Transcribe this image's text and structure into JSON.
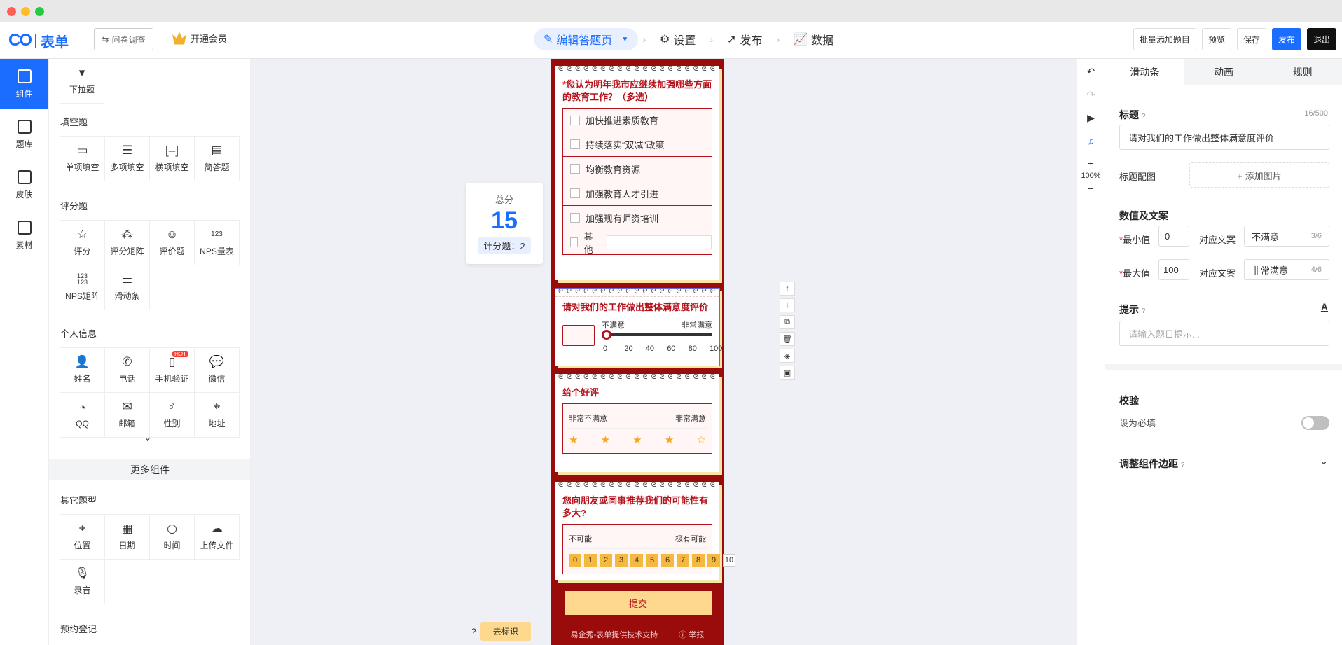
{
  "header": {
    "logo_mark": "CO",
    "logo_text": "表单",
    "survey_btn": "问卷调查",
    "vip": "开通会员",
    "steps": [
      "编辑答题页",
      "设置",
      "发布",
      "数据"
    ],
    "buttons": {
      "batch": "批量添加题目",
      "preview": "预览",
      "save": "保存",
      "publish": "发布",
      "exit": "退出"
    }
  },
  "leftnav": [
    {
      "label": "组件"
    },
    {
      "label": "题库"
    },
    {
      "label": "皮肤"
    },
    {
      "label": "素材"
    }
  ],
  "panel": {
    "dropdown_label": "下拉题",
    "fill_title": "填空题",
    "fill_items": [
      "单项填空",
      "多项填空",
      "横项填空",
      "简答题"
    ],
    "rating_title": "评分题",
    "rating_items": [
      "评分",
      "评分矩阵",
      "评价题",
      "NPS量表",
      "NPS矩阵",
      "滑动条"
    ],
    "personal_title": "个人信息",
    "personal_items": [
      "姓名",
      "电话",
      "手机验证",
      "微信",
      "QQ",
      "邮箱",
      "性别",
      "地址"
    ],
    "hot": "HOT",
    "more": "更多组件",
    "other_title": "其它题型",
    "other_items": [
      "位置",
      "日期",
      "时间",
      "上传文件",
      "录音"
    ],
    "booking_title": "预约登记"
  },
  "score": {
    "label": "总分",
    "value": "15",
    "count": "计分题：2"
  },
  "q1": {
    "star": "*",
    "title": "您认为明年我市应继续加强哪些方面的教育工作？（多选）",
    "options": [
      "加快推进素质教育",
      "持续落实“双减”政策",
      "均衡教育资源",
      "加强教育人才引进",
      "加强现有师资培训",
      "其他"
    ]
  },
  "q2": {
    "title": "请对我们的工作做出整体满意度评价",
    "min_text": "不满意",
    "max_text": "非常满意",
    "ticks": [
      "0",
      "20",
      "40",
      "60",
      "80",
      "100"
    ],
    "value": 0
  },
  "q3": {
    "title": "给个好评",
    "min_text": "非常不满意",
    "max_text": "非常满意",
    "stars_filled": 4,
    "stars_total": 5
  },
  "q4": {
    "title": "您向朋友或同事推荐我们的可能性有多大?",
    "min_text": "不可能",
    "max_text": "极有可能",
    "nums": [
      "0",
      "1",
      "2",
      "3",
      "4",
      "5",
      "6",
      "7",
      "8",
      "9",
      "10"
    ]
  },
  "submit": "提交",
  "footer_support": "易企秀-表单提供技术支持",
  "footer_report": "举报",
  "remove_mark": "去标识",
  "zoom": "100%",
  "rpanel": {
    "tabs": [
      "滑动条",
      "动画",
      "规则"
    ],
    "title_label": "标题",
    "title_count": "16/500",
    "title_value": "请对我们的工作做出整体满意度评价",
    "img_label": "标题配图",
    "img_btn": "+ 添加图片",
    "values_label": "数值及文案",
    "min_label": "最小值",
    "min_val": "0",
    "map_label": "对应文案",
    "min_text": "不满意",
    "min_count": "3/6",
    "max_label": "最大值",
    "max_val": "100",
    "max_text": "非常满意",
    "max_count": "4/6",
    "hint_label": "提示",
    "hint_placeholder": "请输入题目提示...",
    "check_label": "校验",
    "required_label": "设为必填",
    "padding_label": "调整组件边距"
  },
  "colors": {
    "accent": "#1a6dff",
    "theme": "#9a0c0c",
    "title_red": "#b5121b"
  }
}
